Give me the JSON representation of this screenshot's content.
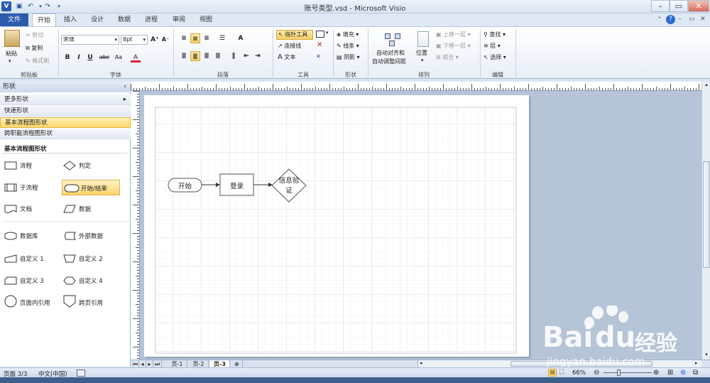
{
  "window": {
    "title": "账号类型.vsd - Microsoft Visio"
  },
  "tabs": [
    {
      "label": "文件"
    },
    {
      "label": "开始"
    },
    {
      "label": "插入"
    },
    {
      "label": "设计"
    },
    {
      "label": "数据"
    },
    {
      "label": "进程"
    },
    {
      "label": "审阅"
    },
    {
      "label": "视图"
    }
  ],
  "ribbon": {
    "clipboard": {
      "paste": "粘贴",
      "cut": "剪切",
      "copy": "复制",
      "format_painter": "格式刷",
      "group": "剪贴板"
    },
    "font": {
      "name": "宋体",
      "size": "8pt",
      "bold": "B",
      "italic": "I",
      "underline": "U",
      "strike": "abc",
      "case": "Aa",
      "color": "A",
      "group": "字体"
    },
    "paragraph": {
      "group": "段落"
    },
    "tools": {
      "pointer": "指针工具",
      "connector": "连接线",
      "text": "文本",
      "group": "工具"
    },
    "shape": {
      "fill": "填充",
      "line": "线条",
      "shadow": "阴影",
      "group": "形状"
    },
    "arrange": {
      "auto_align": "自动对齐和",
      "auto_space": "自动调整间距",
      "position": "位置",
      "bring_forward": "上移一层",
      "send_backward": "下移一层",
      "group_btn": "组合",
      "group": "排列"
    },
    "editing": {
      "find": "查找",
      "layers": "层",
      "select": "选择",
      "group": "编辑"
    }
  },
  "shapes_pane": {
    "header": "形状",
    "stencils": [
      {
        "label": "更多形状"
      },
      {
        "label": "快速形状"
      },
      {
        "label": "基本流程图形状"
      },
      {
        "label": "跨职能流程图形状"
      }
    ],
    "section_title": "基本流程图形状",
    "masters": [
      {
        "label": "流程"
      },
      {
        "label": "判定"
      },
      {
        "label": "子流程"
      },
      {
        "label": "开始/结束"
      },
      {
        "label": "文档"
      },
      {
        "label": "数据"
      },
      {
        "label": "数据库"
      },
      {
        "label": "外部数据"
      },
      {
        "label": "自定义 1"
      },
      {
        "label": "自定义 2"
      },
      {
        "label": "自定义 3"
      },
      {
        "label": "自定义 4"
      },
      {
        "label": "页面内引用"
      },
      {
        "label": "跨页引用"
      }
    ]
  },
  "diagram": {
    "start": "开始",
    "login": "登录",
    "verify_line1": "信息验",
    "verify_line2": "证"
  },
  "page_tabs": [
    {
      "label": "页-1"
    },
    {
      "label": "页-2"
    },
    {
      "label": "页-3"
    }
  ],
  "status": {
    "page": "页面 3/3",
    "language": "中文(中国)",
    "zoom": "66%"
  },
  "watermark": {
    "brand": "Bai",
    "cn": "经验",
    "url": "jingyan.baidu.com"
  }
}
